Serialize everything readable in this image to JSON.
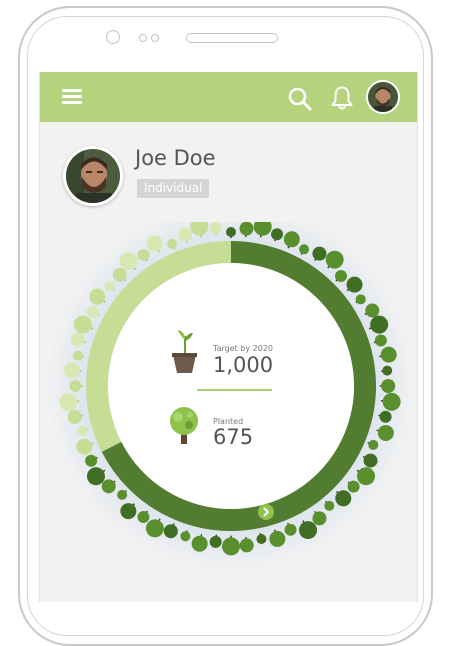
{
  "user": {
    "name": "Joe Doe",
    "type": "Individual"
  },
  "target": {
    "label": "Target by 2020",
    "value": "1,000"
  },
  "planted": {
    "label": "Planted",
    "value": "675"
  },
  "progress": {
    "planted_fraction": 0.675
  },
  "icons": {
    "menu": "menu-icon",
    "search": "search-icon",
    "notifications": "bell-icon",
    "detail": "chevron-right-icon"
  },
  "colors": {
    "appbar": "#b5d27d",
    "planted_arc": "#527c30",
    "remaining_arc": "#c6dd96",
    "accent": "#8fc24a"
  }
}
